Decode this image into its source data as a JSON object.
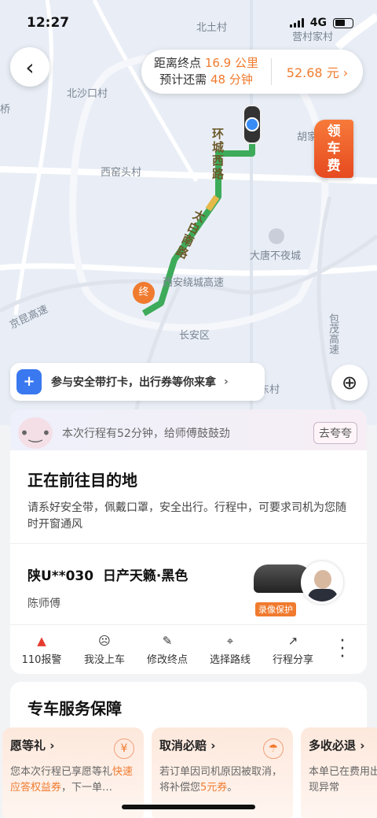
{
  "status_bar": {
    "time": "12:27",
    "network": "4G"
  },
  "map": {
    "labels": [
      "北土村",
      "北沙口村",
      "桥",
      "胡家",
      "西窑头村",
      "大唐不夜城",
      "西安绕城高速",
      "京昆高速",
      "长安区",
      "包茂高速",
      "营村",
      "家村",
      "东村"
    ],
    "road_labels": [
      "环城西路",
      "太白南路"
    ],
    "end_marker": "终"
  },
  "trip_info": {
    "dist_prefix": "距离终点",
    "dist_value": "16.9 公里",
    "time_prefix": "预计还需",
    "time_value": "48 分钟",
    "fare": "52.68 元",
    "fare_chevron": "›"
  },
  "coupon": {
    "line1": "领",
    "line2": "车",
    "line3": "费"
  },
  "safety_banner": {
    "text": "参与安全带打卡，出行券等你来拿",
    "chevron": "›"
  },
  "encourage": {
    "text": "本次行程有52分钟，给师傅鼓鼓劲",
    "button": "去夸夸"
  },
  "status_card": {
    "title": "正在前往目的地",
    "desc": "请系好安全带，佩戴口罩，安全出行。行程中，可要求司机为您随时开窗通风"
  },
  "driver": {
    "plate": "陕U**030",
    "car": "日产天籁·黑色",
    "name": "陈师傅",
    "record_badge": "录像保护"
  },
  "actions": [
    {
      "label": "110报警",
      "icon": "alarm-icon"
    },
    {
      "label": "我没上车",
      "icon": "sad-face-icon"
    },
    {
      "label": "修改终点",
      "icon": "pencil-icon"
    },
    {
      "label": "选择路线",
      "icon": "route-icon"
    },
    {
      "label": "行程分享",
      "icon": "share-icon"
    }
  ],
  "service": {
    "title": "专车服务保障",
    "tiles": [
      {
        "title": "愿等礼 ›",
        "desc_a": "您本次行程已享愿等礼",
        "desc_b": "快速应答权益券",
        "desc_c": "，下一单…",
        "badge": "¥"
      },
      {
        "title": "取消必赔 ›",
        "desc_a": "若订单因司机原因被取消，将补偿您",
        "desc_b": "5元券",
        "desc_c": "。",
        "badge": "☂"
      },
      {
        "title": "多收必退 ›",
        "desc_a": "本单已在费用出现异常",
        "desc_b": "",
        "desc_c": "",
        "badge": ""
      }
    ]
  },
  "colors": {
    "accent": "#f07b2f",
    "route": "#3dab5a",
    "shield": "#3a78f0"
  }
}
